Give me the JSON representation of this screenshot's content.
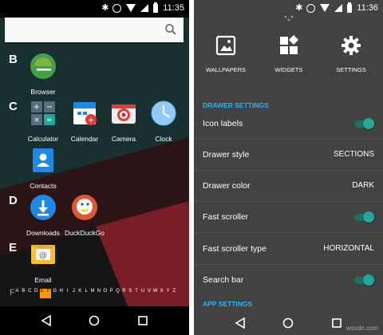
{
  "left": {
    "status_time": "11:35",
    "search": {
      "placeholder": ""
    },
    "sections": [
      {
        "letter": "B"
      },
      {
        "letter": "C"
      },
      {
        "letter": "D"
      },
      {
        "letter": "E"
      }
    ],
    "apps": {
      "browser": "Browser",
      "calculator": "Calculator",
      "calendar": "Calendar",
      "camera": "Camera",
      "clock": "Clock",
      "contacts": "Contacts",
      "downloads": "Downloads",
      "duckduckgo": "DuckDuckGo",
      "email": "Email"
    },
    "fast_scroller": {
      "letters": [
        "A",
        "B",
        "C",
        "D",
        "E",
        "F",
        "G",
        "H",
        "I",
        "J",
        "K",
        "L",
        "M",
        "N",
        "O",
        "P",
        "Q",
        "R",
        "S",
        "T",
        "U",
        "V",
        "W",
        "X",
        "Y",
        "Z"
      ],
      "highlighted": [
        "E",
        "F"
      ]
    },
    "fast_letter": "F"
  },
  "right": {
    "status_time": "11:36",
    "top_actions": {
      "wallpapers": "WALLPAPERS",
      "widgets": "WIDGETS",
      "settings": "SETTINGS"
    },
    "drawer_header": "DRAWER SETTINGS",
    "rows": {
      "icon_labels": {
        "label": "Icon labels",
        "toggle": true
      },
      "drawer_style": {
        "label": "Drawer style",
        "value": "SECTIONS"
      },
      "drawer_color": {
        "label": "Drawer color",
        "value": "DARK"
      },
      "fast_scroller": {
        "label": "Fast scroller",
        "toggle": true
      },
      "fast_scroller_type": {
        "label": "Fast scroller type",
        "value": "HORIZONTAL"
      },
      "search_bar": {
        "label": "Search bar",
        "toggle": true
      }
    },
    "app_header": "APP SETTINGS"
  },
  "watermark": "wsxdn.com",
  "colors": {
    "accent_blue": "#29b6f6",
    "toggle_on": "#26a69a",
    "drawer_bg": "#424242"
  }
}
